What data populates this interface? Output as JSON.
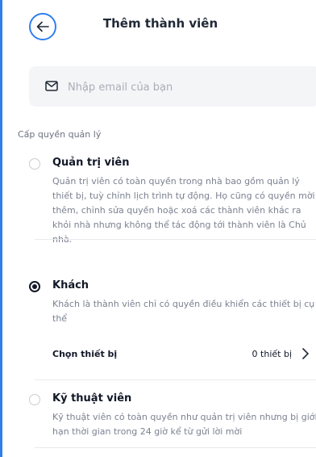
{
  "header": {
    "title": "Thêm thành viên",
    "back_icon": "arrow-left-icon"
  },
  "email": {
    "placeholder": "Nhập email của bạn",
    "value": "",
    "icon": "mail-icon"
  },
  "section_label": "Cấp quyền quản lý",
  "options": [
    {
      "title": "Quản trị viên",
      "selected": false,
      "description": "Quản trị viên có toàn quyền trong nhà bao gồm quản lý thiết bị, tuỳ chỉnh lịch trình tự động. Họ cũng có quyền mời thêm, chỉnh sửa quyền hoặc xoá các thành viên khác ra khỏi nhà nhưng không thể tác động tới thành viên là Chủ nhà."
    },
    {
      "title": "Khách",
      "selected": true,
      "description": "Khách là thành viên chỉ có quyền điều khiển các thiết bị cụ thể",
      "select_row": {
        "label": "Chọn thiết bị",
        "value": "0 thiết bị",
        "icon": "chevron-right-icon"
      }
    },
    {
      "title": "Kỹ thuật viên",
      "selected": false,
      "description": "Kỹ thuật viên có toàn quyền như quản trị viên nhưng bị giới hạn thời gian trong 24 giờ kể từ gửi lời mời"
    }
  ],
  "colors": {
    "accent": "#2f80ed",
    "text": "#1f2937",
    "muted": "#7b8190",
    "input_bg": "#f4f5f7",
    "radio_selected": "#111827"
  }
}
